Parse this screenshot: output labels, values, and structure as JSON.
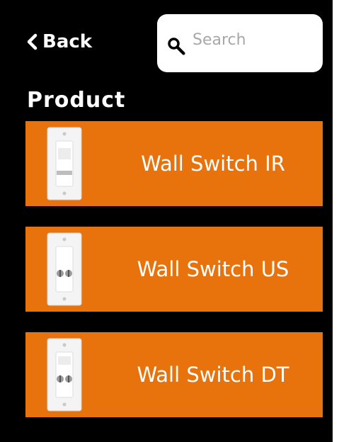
{
  "nav": {
    "back_label": "Back"
  },
  "search": {
    "placeholder": "Search",
    "value": ""
  },
  "section_title": "Product",
  "products": [
    {
      "label": "Wall Switch IR",
      "variant": "ir"
    },
    {
      "label": "Wall Switch US",
      "variant": "us"
    },
    {
      "label": "Wall Switch DT",
      "variant": "dt"
    }
  ],
  "edge_mark": "1",
  "colors": {
    "background": "#000000",
    "accent": "#e8720c",
    "text": "#ffffff"
  }
}
